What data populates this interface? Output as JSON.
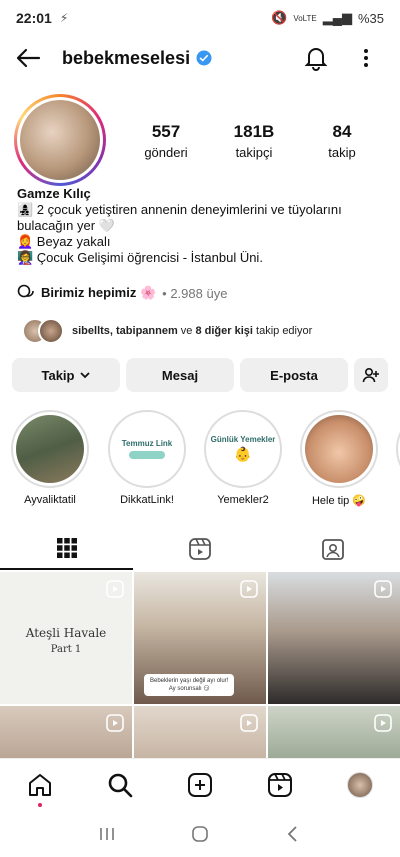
{
  "status": {
    "time": "22:01",
    "battery": "%35",
    "network": "VoLTE"
  },
  "header": {
    "username": "bebekmeselesi"
  },
  "stats": [
    {
      "value": "557",
      "label": "gönderi"
    },
    {
      "value": "181B",
      "label": "takipçi"
    },
    {
      "value": "84",
      "label": "takip"
    }
  ],
  "bio": {
    "name": "Gamze Kılıç",
    "line1": "👩‍👧‍👦 2 çocuk yetiştiren annenin deneyimlerini ve tüyolarını bulacağın yer 🤍",
    "line2": "👩‍🦰 Beyaz yakalı",
    "line3": "👩‍🏫 Çocuk Gelişimi öğrencisi - İstanbul Üni."
  },
  "community": {
    "name": "Birimiz hepimiz 🌸",
    "members": "• 2.988 üye"
  },
  "followed_by": {
    "names": "sibellts, tabipannem",
    "rest": " ve ",
    "others": "8 diğer kişi",
    "suffix": " takip ediyor"
  },
  "buttons": {
    "follow": "Takip",
    "message": "Mesaj",
    "email": "E-posta"
  },
  "highlights": [
    {
      "label": "Ayvaliktatil",
      "text": ""
    },
    {
      "label": "DikkatLink!",
      "text": "Temmuz Link"
    },
    {
      "label": "Yemekler2",
      "text": "Günlük Yemekler"
    },
    {
      "label": "Hele tip 🤪",
      "text": ""
    }
  ],
  "grid": {
    "post1_line1": "Ateşli Havale",
    "post1_line2": "Part 1",
    "post2_overlay_line1": "Bebeklerin yaşı değil ayı olur!",
    "post2_overlay_line2": "Ay sorunsalı 😏"
  },
  "colors": {
    "verified": "#3897f0",
    "accent": "#e0245e"
  }
}
